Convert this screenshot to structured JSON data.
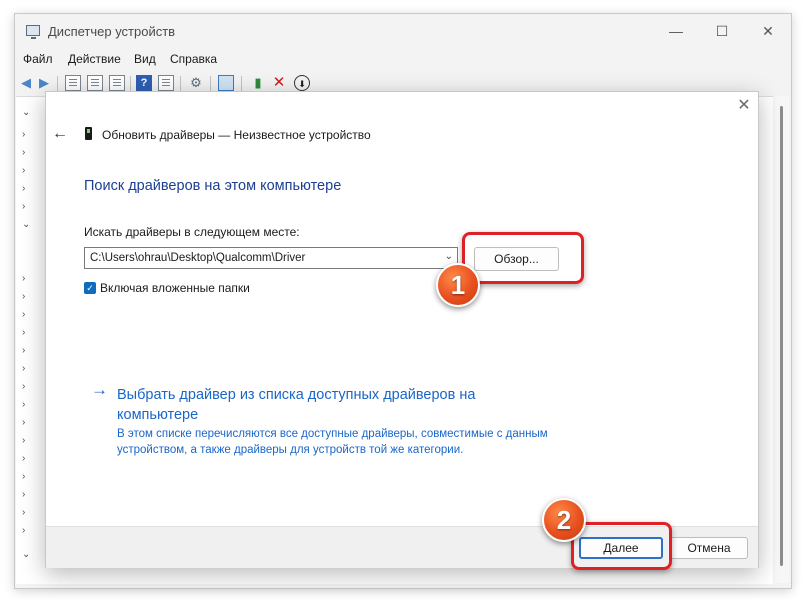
{
  "window": {
    "title": "Диспетчер устройств",
    "controls": {
      "minimize": "—",
      "maximize": "☐",
      "close": "✕"
    }
  },
  "menu": [
    "Файл",
    "Действие",
    "Вид",
    "Справка"
  ],
  "tree": {
    "expanded_glyph": "⌄",
    "collapsed_glyph": "›"
  },
  "dialog": {
    "close_glyph": "✕",
    "back_glyph": "←",
    "header": "Обновить драйверы — Неизвестное устройство",
    "section_title": "Поиск драйверов на этом компьютере",
    "path_label": "Искать драйверы в следующем месте:",
    "path_value": "C:\\Users\\ohrau\\Desktop\\Qualcomm\\Driver",
    "combo_arrow": "⌄",
    "browse_button": "Обзор...",
    "include_subfolders_checked": true,
    "include_subfolders_label": "Включая вложенные папки",
    "link_arrow": "→",
    "pick_driver_link": "Выбрать драйвер из списка доступных драйверов на компьютере",
    "pick_driver_desc": "В этом списке перечисляются все доступные драйверы, совместимые с данным устройством, а также драйверы для устройств той же категории.",
    "next_button": "Далее",
    "cancel_button": "Отмена"
  },
  "annotations": {
    "step1": "1",
    "step2": "2",
    "highlight_color": "#e02027",
    "badge_color": "#e8501f"
  },
  "colors": {
    "accent": "#0f6cbd",
    "link": "#1a66c9",
    "heading": "#1c3f94"
  }
}
